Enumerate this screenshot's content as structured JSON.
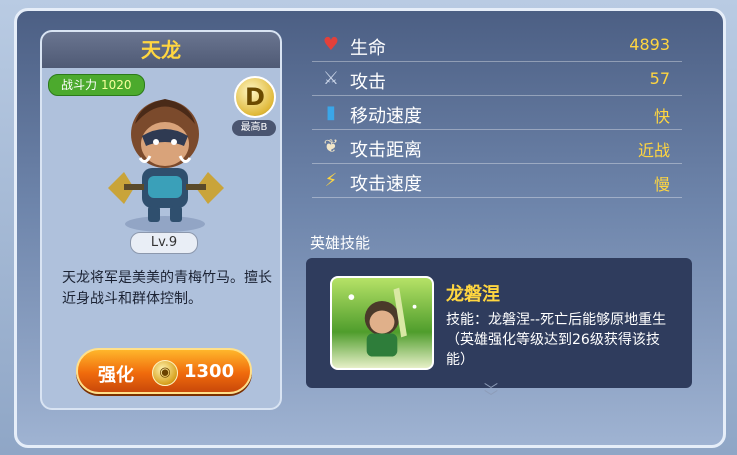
{
  "hero": {
    "name": "天龙",
    "power_label": "战斗力",
    "power_value": "1020",
    "grade": "D",
    "grade_max": "最高B",
    "level": "Lv.9",
    "description": "天龙将军是美美的青梅竹马。擅长近身战斗和群体控制。",
    "upgrade_label": "强化",
    "upgrade_cost": "1300"
  },
  "stats": [
    {
      "icon": "heart-icon",
      "name": "生命",
      "value": "4893"
    },
    {
      "icon": "sword-icon",
      "name": "攻击",
      "value": "57"
    },
    {
      "icon": "boots-icon",
      "name": "移动速度",
      "value": "快"
    },
    {
      "icon": "feather-icon",
      "name": "攻击距离",
      "value": "近战"
    },
    {
      "icon": "lightning-icon",
      "name": "攻击速度",
      "value": "慢"
    }
  ],
  "skill": {
    "section_title": "英雄技能",
    "name": "龙磐涅",
    "description": "技能：龙磐涅--死亡后能够原地重生（英雄强化等级达到26级获得该技能）"
  },
  "colors": {
    "accent": "#ffd640",
    "upgrade_button": "#f06b0c",
    "panel": "#4c5f84"
  }
}
